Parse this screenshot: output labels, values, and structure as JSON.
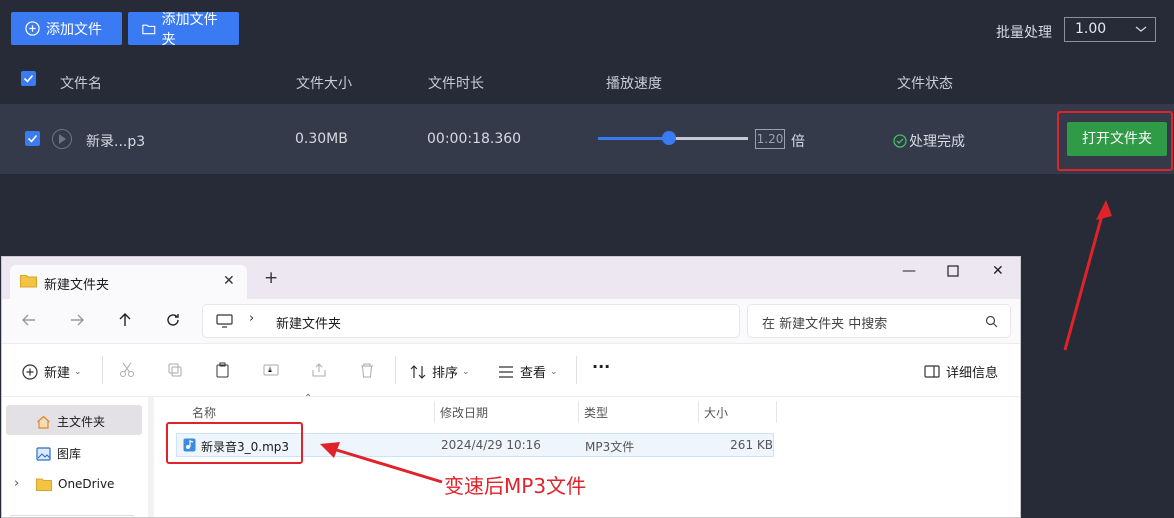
{
  "app": {
    "add_file_label": "添加文件",
    "add_folder_label": "添加文件夹",
    "batch_label": "批量处理",
    "batch_value": "1.00",
    "columns": {
      "filename": "文件名",
      "filesize": "文件大小",
      "duration": "文件时长",
      "speed": "播放速度",
      "status": "文件状态"
    },
    "row": {
      "filename": "新录...p3",
      "filesize": "0.30MB",
      "duration": "00:00:18.360",
      "speed_value": "1.20",
      "speed_unit": "倍",
      "speed_fraction": 0.47,
      "status": "处理完成",
      "open_folder_label": "打开文件夹"
    },
    "colors": {
      "background": "#272b38",
      "row_background": "#343a4a",
      "accent": "#3a7bf3",
      "green": "#2f9b47",
      "highlight_red": "#e0222a"
    }
  },
  "explorer": {
    "tab_title": "新建文件夹",
    "breadcrumb": "新建文件夹",
    "search_placeholder": "在 新建文件夹 中搜索",
    "toolbar": {
      "new_label": "新建",
      "sort_label": "排序",
      "view_label": "查看",
      "more_label": "···",
      "details_label": "详细信息"
    },
    "sidebar": [
      {
        "label": "主文件夹",
        "icon": "home-icon"
      },
      {
        "label": "图库",
        "icon": "gallery-icon"
      },
      {
        "label": "OneDrive",
        "icon": "folder-icon"
      }
    ],
    "columns": {
      "name": "名称",
      "modified": "修改日期",
      "type": "类型",
      "size": "大小"
    },
    "files": [
      {
        "name": "新录音3_0.mp3",
        "modified": "2024/4/29 10:16",
        "type": "MP3文件",
        "size": "261 KB"
      }
    ]
  },
  "annotation": {
    "label": "变速后MP3文件"
  }
}
